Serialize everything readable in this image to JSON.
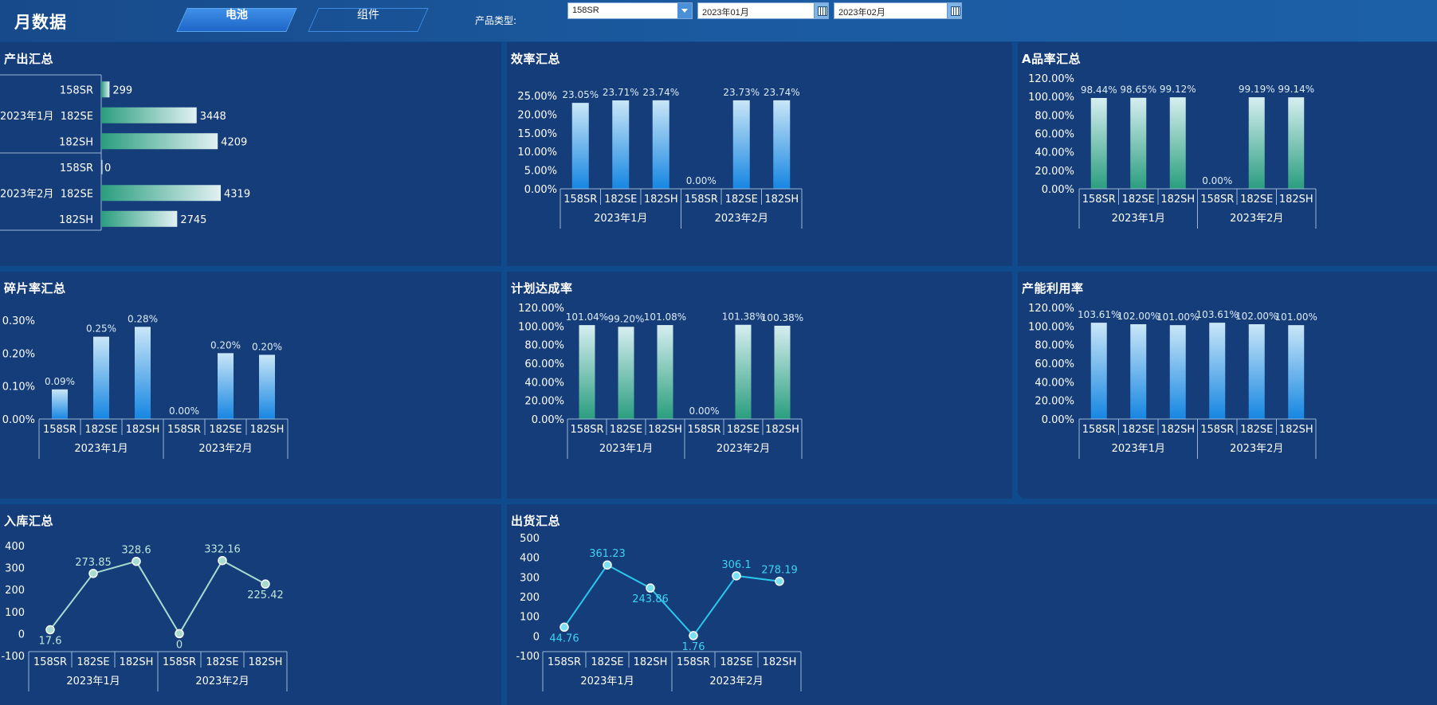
{
  "header": {
    "title": "月数据",
    "tabs": [
      {
        "label": "电池",
        "active": true
      },
      {
        "label": "组件",
        "active": false
      }
    ],
    "filter_label": "产品类型:",
    "product_type": "158SR",
    "start_month": "2023年01月",
    "end_month": "2023年02月"
  },
  "colors": {
    "background": "#0e4a8c",
    "panel": "#153d7a",
    "blue_bar_top": "#c9e6f7",
    "blue_bar_bottom": "#1686e2",
    "green_bar_top": "#d6eef0",
    "green_bar_bottom": "#2a9e7e",
    "rk_line": "#a7dccf",
    "ship_line": "#2cc8ec"
  },
  "panels": {
    "output": "产出汇总",
    "efficiency": "效率汇总",
    "a_rate": "A品率汇总",
    "fragment": "碎片率汇总",
    "plan": "计划达成率",
    "capacity": "产能利用率",
    "inbound": "入库汇总",
    "shipment": "出货汇总"
  },
  "chart_data": [
    {
      "id": "output",
      "type": "bar",
      "orientation": "horizontal",
      "groups": [
        "2023年1月",
        "2023年2月"
      ],
      "categories": [
        "158SR",
        "182SE",
        "182SH"
      ],
      "values": [
        299,
        3448,
        4209,
        0,
        4319,
        2745
      ],
      "labels": [
        "299",
        "3448",
        "4209",
        "0",
        "4319",
        "2745"
      ]
    },
    {
      "id": "efficiency",
      "type": "bar",
      "groups": [
        "2023年1月",
        "2023年2月"
      ],
      "categories": [
        "158SR",
        "182SE",
        "182SH"
      ],
      "values": [
        23.05,
        23.71,
        23.74,
        0,
        23.73,
        23.74
      ],
      "labels": [
        "23.05%",
        "23.71%",
        "23.74%",
        "0.00%",
        "23.73%",
        "23.74%"
      ],
      "yticks": [
        "0.00%",
        "5.00%",
        "10.00%",
        "15.00%",
        "20.00%",
        "25.00%"
      ],
      "ylim": [
        0,
        25
      ]
    },
    {
      "id": "a_rate",
      "type": "bar",
      "groups": [
        "2023年1月",
        "2023年2月"
      ],
      "categories": [
        "158SR",
        "182SE",
        "182SH"
      ],
      "values": [
        98.44,
        98.65,
        99.12,
        0,
        99.19,
        99.14
      ],
      "labels": [
        "98.44%",
        "98.65%",
        "99.12%",
        "0.00%",
        "99.19%",
        "99.14%"
      ],
      "yticks": [
        "0.00%",
        "20.00%",
        "40.00%",
        "60.00%",
        "80.00%",
        "100.00%",
        "120.00%"
      ],
      "ylim": [
        0,
        120
      ]
    },
    {
      "id": "fragment",
      "type": "bar",
      "groups": [
        "2023年1月",
        "2023年2月"
      ],
      "categories": [
        "158SR",
        "182SE",
        "182SH"
      ],
      "values": [
        0.09,
        0.25,
        0.28,
        0,
        0.2,
        0.195
      ],
      "labels": [
        "0.09%",
        "0.25%",
        "0.28%",
        "0.00%",
        "0.20%",
        "0.20%"
      ],
      "yticks": [
        "0.00%",
        "0.10%",
        "0.20%",
        "0.30%"
      ],
      "ylim": [
        0,
        0.3
      ]
    },
    {
      "id": "plan",
      "type": "bar",
      "groups": [
        "2023年1月",
        "2023年2月"
      ],
      "categories": [
        "158SR",
        "182SE",
        "182SH"
      ],
      "values": [
        101.04,
        99.2,
        101.08,
        0,
        101.38,
        100.38
      ],
      "labels": [
        "101.04%",
        "99.20%",
        "101.08%",
        "0.00%",
        "101.38%",
        "100.38%"
      ],
      "yticks": [
        "0.00%",
        "20.00%",
        "40.00%",
        "60.00%",
        "80.00%",
        "100.00%",
        "120.00%"
      ],
      "ylim": [
        0,
        120
      ]
    },
    {
      "id": "capacity",
      "type": "bar",
      "groups": [
        "2023年1月",
        "2023年2月"
      ],
      "categories": [
        "158SR",
        "182SE",
        "182SH"
      ],
      "values": [
        103.61,
        102.0,
        101.0,
        103.61,
        102.0,
        101.0
      ],
      "labels": [
        "103.61%",
        "102.00%",
        "101.00%",
        "103.61%",
        "102.00%",
        "101.00%"
      ],
      "yticks": [
        "0.00%",
        "20.00%",
        "40.00%",
        "60.00%",
        "80.00%",
        "100.00%",
        "120.00%"
      ],
      "ylim": [
        0,
        120
      ]
    },
    {
      "id": "inbound",
      "type": "line",
      "groups": [
        "2023年1月",
        "2023年2月"
      ],
      "categories": [
        "158SR",
        "182SE",
        "182SH"
      ],
      "values": [
        17.6,
        273.85,
        328.6,
        0,
        332.16,
        225.42
      ],
      "labels": [
        "17.6",
        "273.85",
        "328.6",
        "0",
        "332.16",
        "225.42"
      ],
      "yticks": [
        "-100",
        "0",
        "100",
        "200",
        "300",
        "400"
      ],
      "ylim": [
        -100,
        400
      ]
    },
    {
      "id": "shipment",
      "type": "line",
      "groups": [
        "2023年1月",
        "2023年2月"
      ],
      "categories": [
        "158SR",
        "182SE",
        "182SH"
      ],
      "values": [
        44.76,
        361.23,
        243.86,
        1.76,
        306.1,
        278.19
      ],
      "labels": [
        "44.76",
        "361.23",
        "243.86",
        "1.76",
        "306.1",
        "278.19"
      ],
      "yticks": [
        "-100",
        "0",
        "100",
        "200",
        "300",
        "400",
        "500"
      ],
      "ylim": [
        -100,
        500
      ]
    }
  ]
}
